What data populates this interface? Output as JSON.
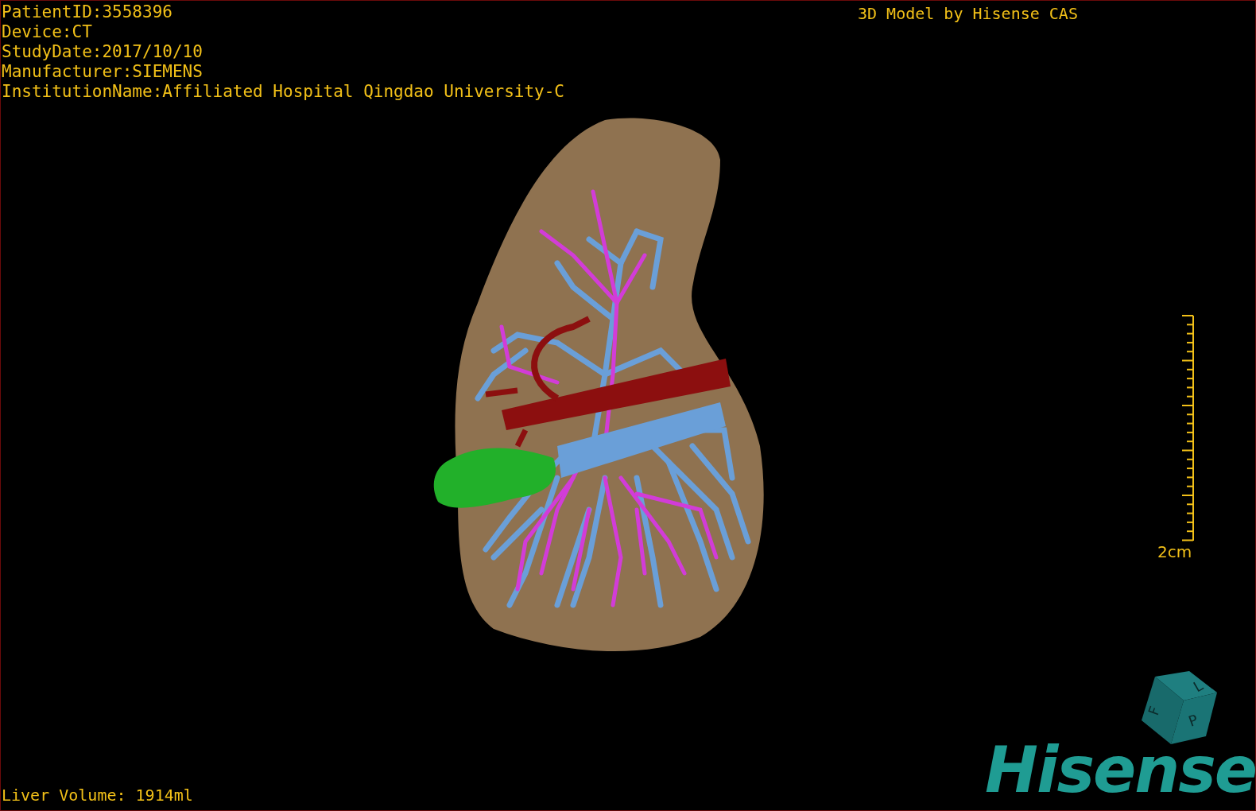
{
  "viewport": {
    "info_lines": [
      "PatientID:3558396",
      "Device:CT",
      "StudyDate:2017/10/10",
      "Manufacturer:SIEMENS",
      "InstitutionName:Affiliated Hospital Qingdao University-C"
    ],
    "title": "3D Model by Hisense CAS",
    "scale_bar": {
      "label": "2cm"
    },
    "orientation_cube": {
      "labels": [
        "F",
        "L",
        "P"
      ]
    },
    "logo": "Hisense",
    "volume": "Liver Volume: 1914ml"
  }
}
